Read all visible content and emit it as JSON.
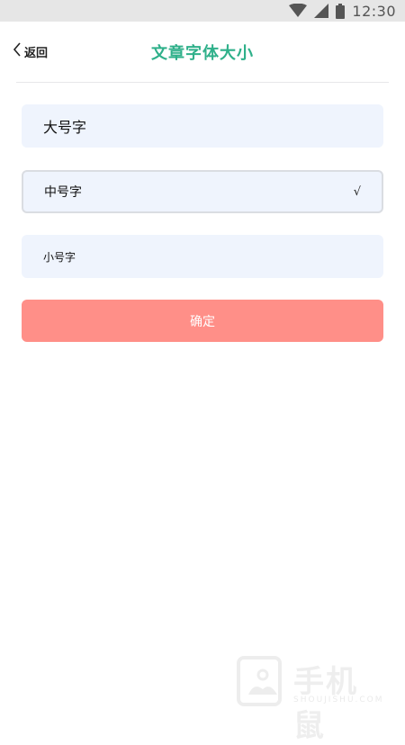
{
  "status_bar": {
    "time": "12:30",
    "icons": [
      "wifi-icon",
      "signal-icon",
      "battery-icon"
    ]
  },
  "header": {
    "back_label": "返回",
    "title": "文章字体大小"
  },
  "options": [
    {
      "label": "大号字",
      "selected": false
    },
    {
      "label": "中号字",
      "selected": true,
      "check": "√"
    },
    {
      "label": "小号字",
      "selected": false
    }
  ],
  "confirm_label": "确定",
  "watermark": {
    "text": "手机鼠",
    "sub": "SHOUJISHU.COM"
  },
  "colors": {
    "title": "#2fb08a",
    "option_bg": "#eff4fd",
    "confirm_bg": "#ff8f88",
    "status_bar_bg": "#e6e6e6"
  }
}
